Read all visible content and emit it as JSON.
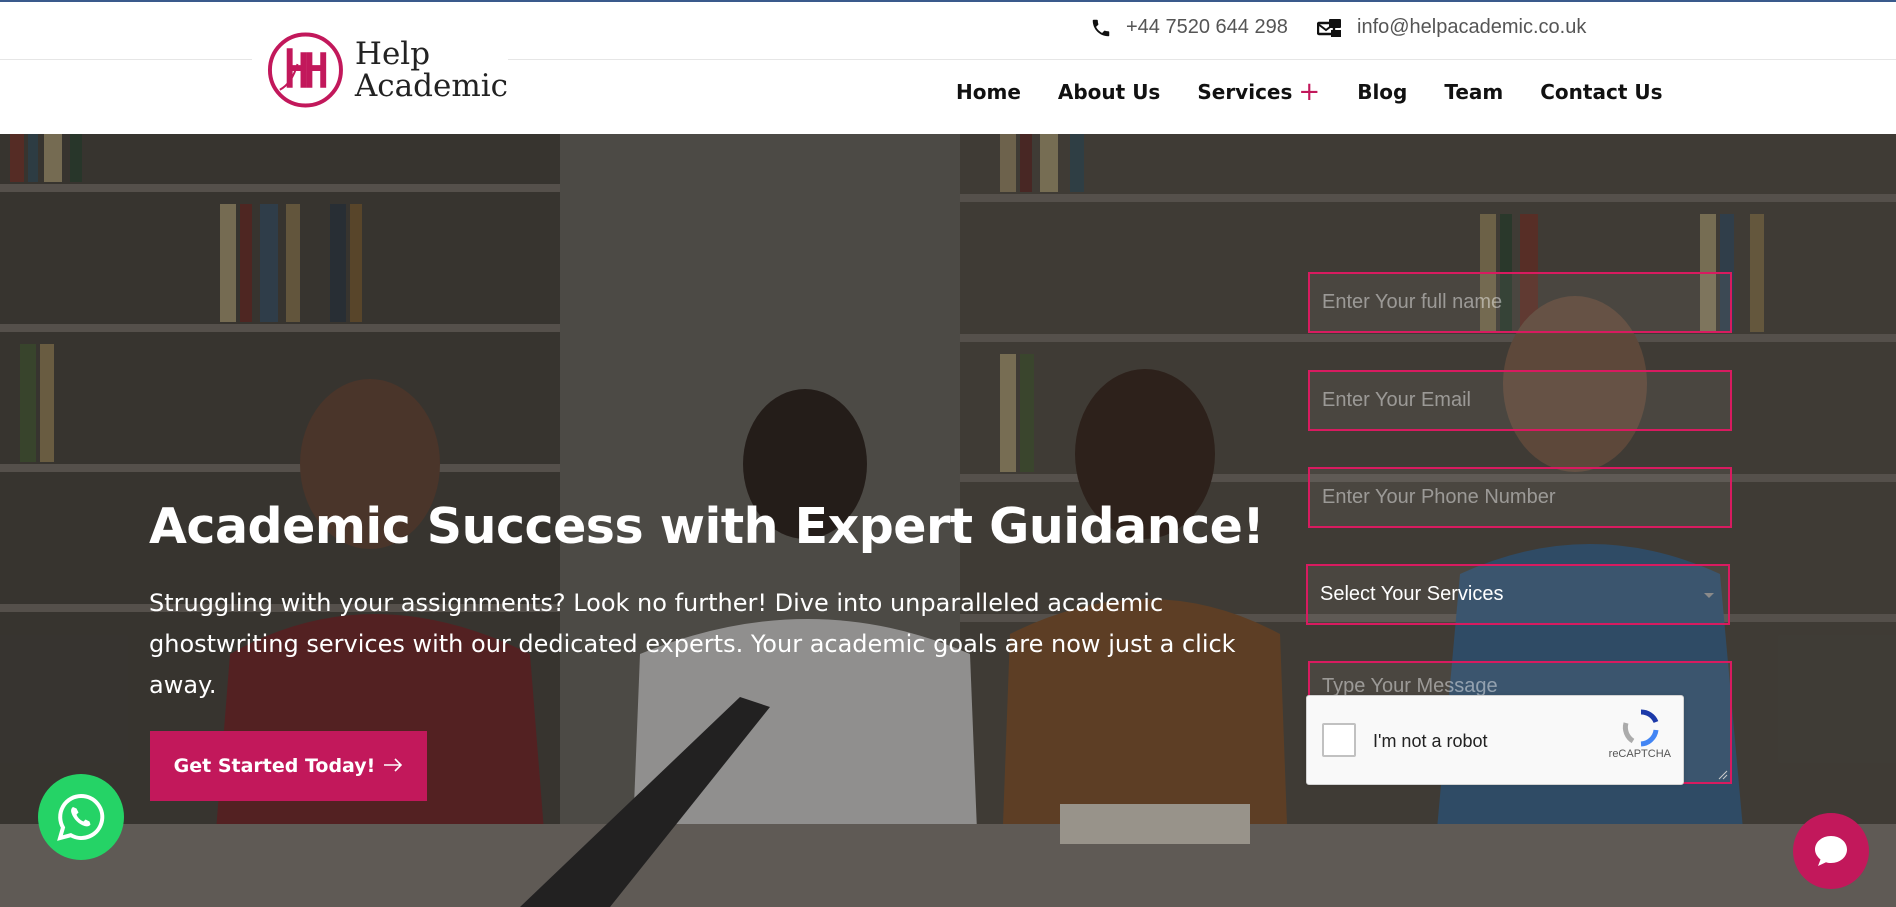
{
  "header": {
    "phone": "+44 7520 644 298",
    "email": "info@helpacademic.co.uk",
    "logo": {
      "line1": "Help",
      "line2": "Academic"
    },
    "nav": [
      {
        "label": "Home"
      },
      {
        "label": "About Us"
      },
      {
        "label": "Services",
        "has_submenu": true
      },
      {
        "label": "Blog"
      },
      {
        "label": "Team"
      },
      {
        "label": "Contact Us"
      }
    ]
  },
  "hero": {
    "title": "Academic Success with Expert Guidance!",
    "text": "Struggling with your assignments? Look no further! Dive into unparalleled academic ghostwriting services with our dedicated experts. Your academic goals are now just a click away.",
    "cta_label": "Get Started Today!"
  },
  "form": {
    "name_placeholder": "Enter Your full name",
    "email_placeholder": "Enter Your Email",
    "phone_placeholder": "Enter Your Phone Number",
    "service_selected": "Select Your Services",
    "message_placeholder": "Type Your Message"
  },
  "captcha": {
    "label": "I'm not a robot",
    "brand": "reCAPTCHA"
  },
  "icons": {
    "phone": "phone-icon",
    "email": "email-icon",
    "whatsapp": "whatsapp-icon",
    "chat": "chat-icon"
  },
  "colors": {
    "accent": "#c2185b",
    "whatsapp": "#25d366"
  }
}
